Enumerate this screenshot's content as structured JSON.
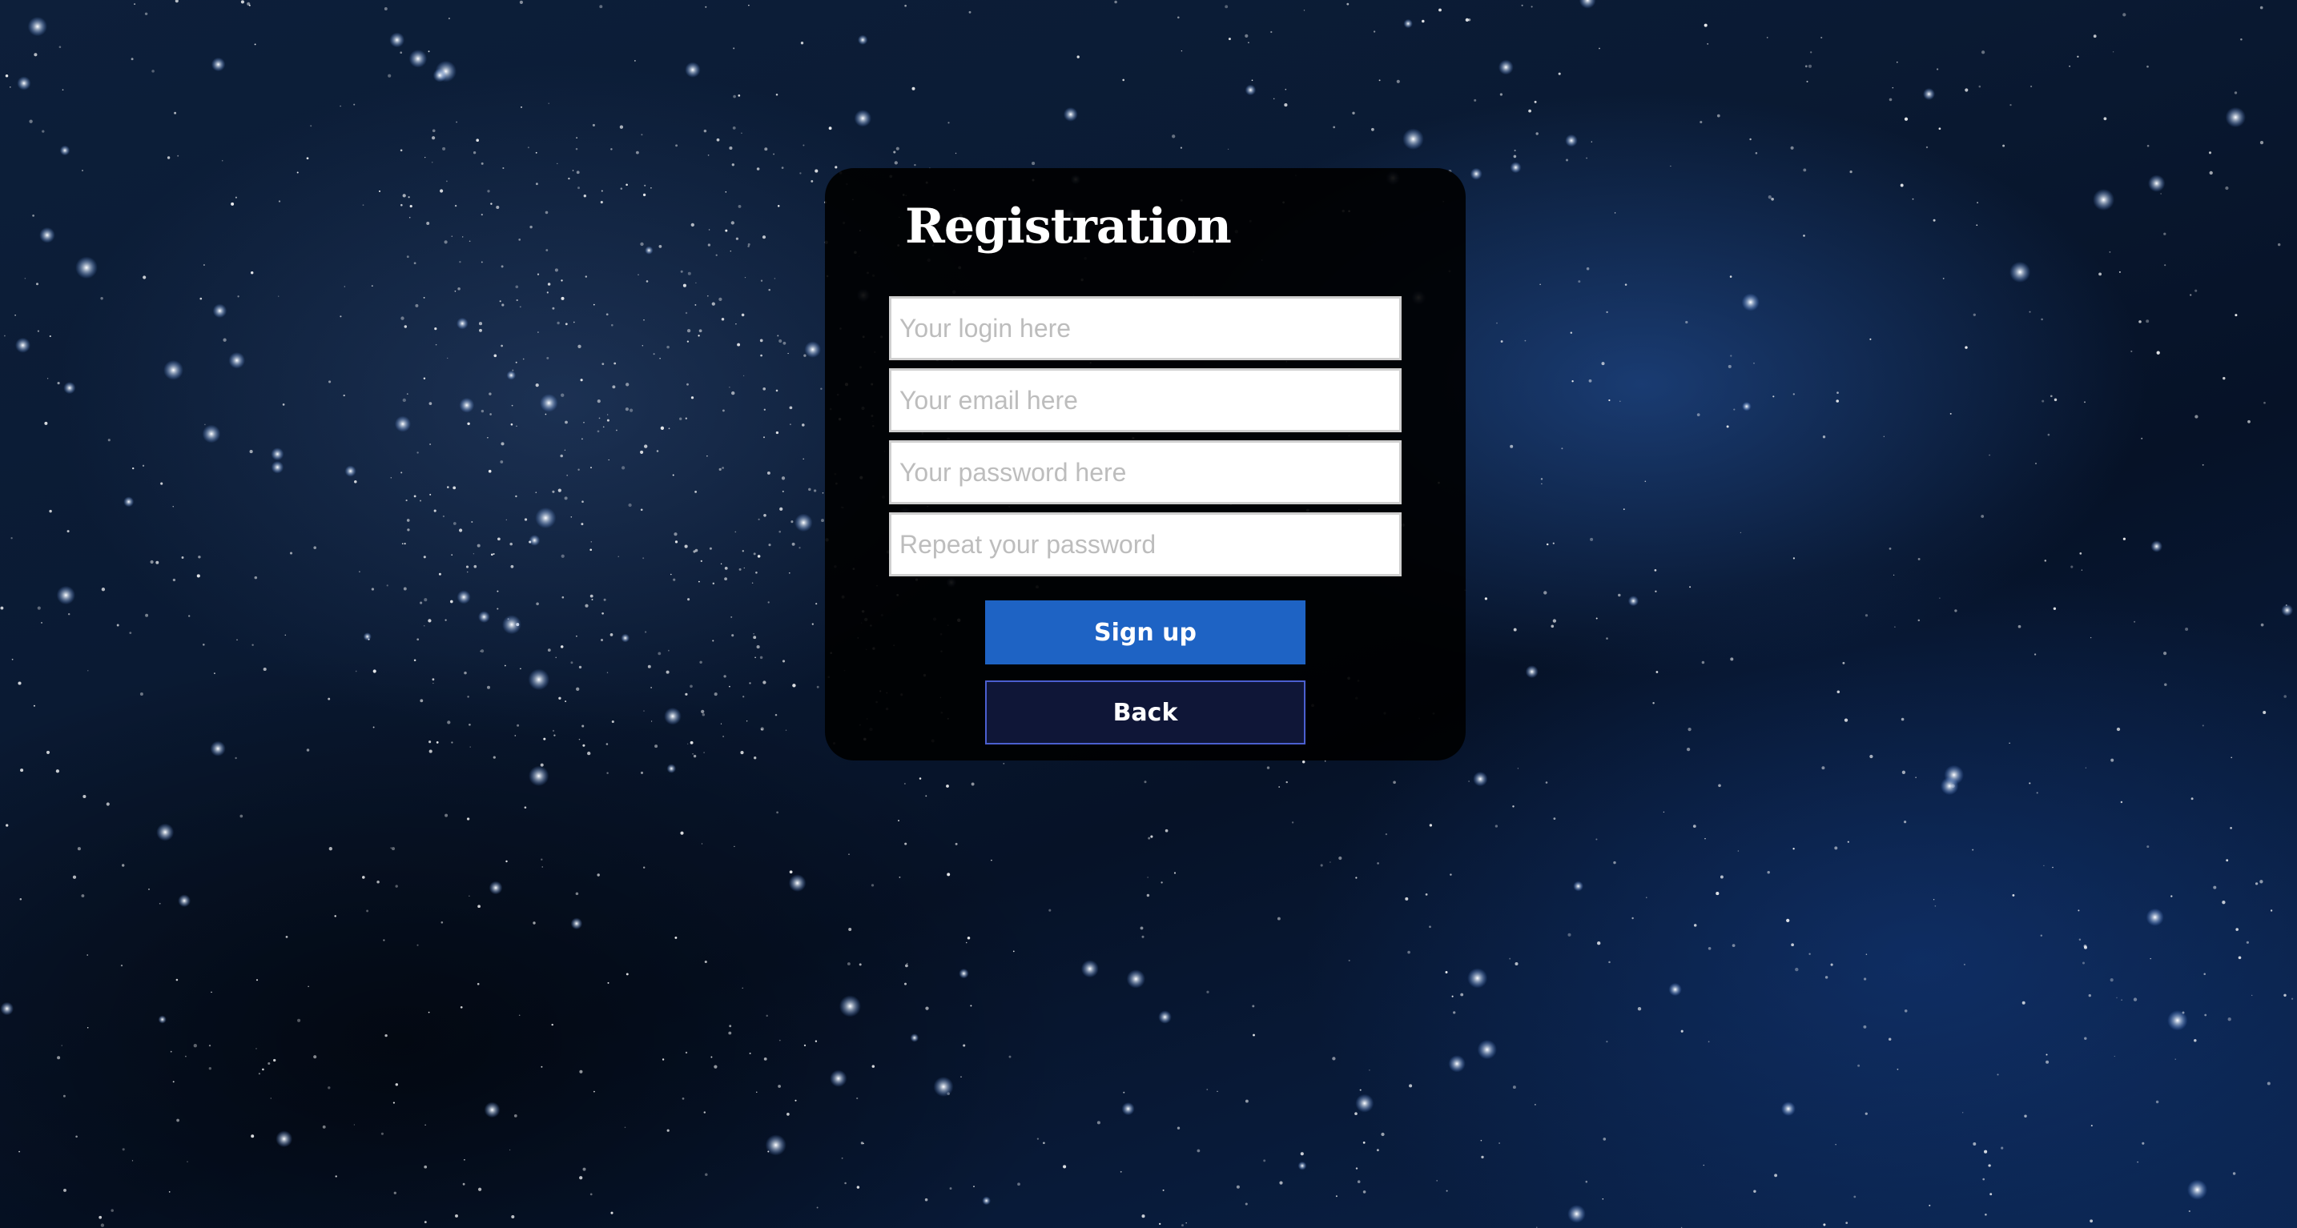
{
  "background": {
    "description_icon": "starfield-background"
  },
  "form": {
    "title": "Registration",
    "fields": [
      {
        "name": "login",
        "placeholder": "Your login here",
        "value": ""
      },
      {
        "name": "email",
        "placeholder": "Your email here",
        "value": ""
      },
      {
        "name": "password",
        "placeholder": "Your password here",
        "value": ""
      },
      {
        "name": "repeat_password",
        "placeholder": "Repeat your password",
        "value": ""
      }
    ],
    "signup_label": "Sign up",
    "back_label": "Back"
  },
  "colors": {
    "signup_button": "#1e63c4",
    "back_button": "#0f1637",
    "back_border": "#4b5fcf",
    "card": "#000000"
  }
}
